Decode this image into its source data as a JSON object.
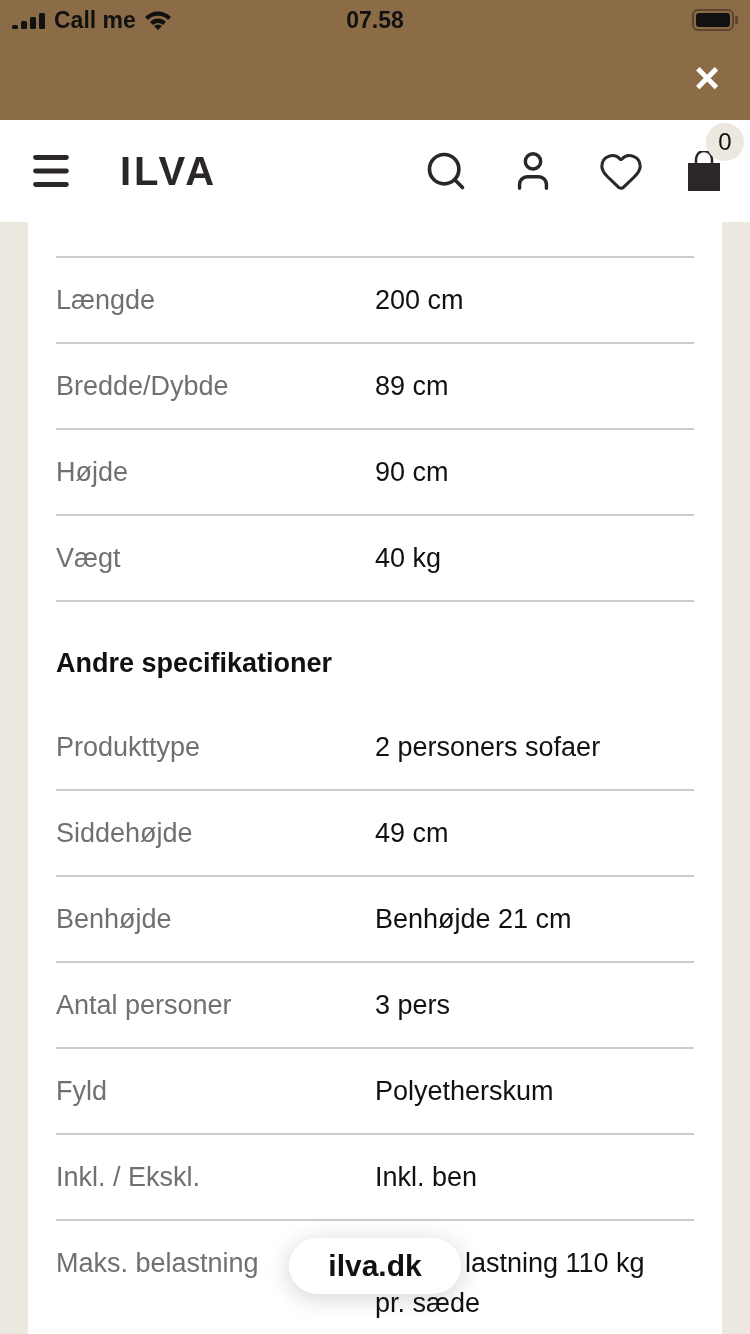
{
  "status_bar": {
    "carrier": "Call me",
    "time": "07.58"
  },
  "banner": {
    "close": "×"
  },
  "header": {
    "logo": "ILVA",
    "cart_count": "0"
  },
  "groups": [
    {
      "rows": [
        {
          "label": "Længde",
          "value": "200 cm"
        },
        {
          "label": "Bredde/Dybde",
          "value": "89 cm"
        },
        {
          "label": "Højde",
          "value": "90 cm"
        },
        {
          "label": "Vægt",
          "value": "40 kg"
        }
      ]
    },
    {
      "title": "Andre specifikationer",
      "rows": [
        {
          "label": "Produkttype",
          "value": "2 personers sofaer"
        },
        {
          "label": "Siddehøjde",
          "value": "49 cm"
        },
        {
          "label": "Benhøjde",
          "value": "Benhøjde 21 cm"
        },
        {
          "label": "Antal personer",
          "value": "3 pers"
        },
        {
          "label": "Fyld",
          "value": "Polyetherskum"
        },
        {
          "label": "Inkl. / Ekskl.",
          "value": "Inkl. ben"
        },
        {
          "label": "Maks. belastning",
          "value": "lastning 110 kg",
          "value_continued": "pr. sæde",
          "partly_covered": true
        }
      ]
    }
  ],
  "url_pill": "ilva.dk"
}
